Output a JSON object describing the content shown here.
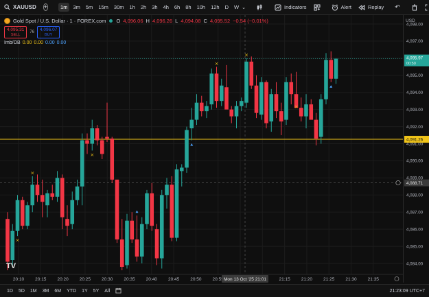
{
  "toolbar": {
    "symbol": "XAUUSD",
    "timeframes": [
      {
        "label": "1m",
        "active": true
      },
      {
        "label": "3m"
      },
      {
        "label": "5m"
      },
      {
        "label": "15m"
      },
      {
        "label": "30m"
      },
      {
        "label": "1h"
      },
      {
        "label": "2h"
      },
      {
        "label": "3h"
      },
      {
        "label": "4h"
      },
      {
        "label": "6h"
      },
      {
        "label": "8h"
      },
      {
        "label": "10h"
      },
      {
        "label": "12h"
      },
      {
        "label": "D"
      },
      {
        "label": "W"
      }
    ],
    "indicators_label": "Indicators",
    "alert_label": "Alert",
    "replay_label": "Replay"
  },
  "legend": {
    "title": "Gold Spot / U.S. Dollar · 1 · FOREX.com",
    "o_label": "O",
    "o_val": "4,096.06",
    "h_label": "H",
    "h_val": "4,096.26",
    "l_label": "L",
    "l_val": "4,094.08",
    "c_label": "C",
    "c_val": "4,095.52",
    "change": "−0.54 (−0.01%)",
    "sell_price": "4,095.31",
    "sell_label": "SELL",
    "spread": "76",
    "buy_price": "4,096.07",
    "buy_label": "BUY",
    "indicator_name": "Imb/OB",
    "indicator_values": [
      "0.00",
      "0.00",
      "0.00",
      "0.00"
    ]
  },
  "price_axis": {
    "currency": "USD",
    "labels": [
      "4,098.00",
      "4,097.00",
      "4,096.00",
      "4,095.00",
      "4,094.00",
      "4,093.00",
      "4,092.00",
      "4,091.00",
      "4,090.00",
      "4,089.00",
      "4,088.00",
      "4,087.00",
      "4,086.00",
      "4,085.00",
      "4,084.00"
    ],
    "current_price": "4,095.97",
    "countdown": "00:50",
    "line_price": "4,091.26",
    "crosshair_price": "4,088.71"
  },
  "time_axis": {
    "labels": [
      "20:10",
      "20:15",
      "20:20",
      "20:25",
      "20:30",
      "20:35",
      "20:40",
      "20:45",
      "20:50",
      "20:55",
      "21:01",
      "21:10",
      "21:15",
      "21:20",
      "21:25",
      "21:30",
      "21:35"
    ],
    "crosshair_time": "Mon 13 Oct '25  21:01"
  },
  "bottombar": {
    "ranges": [
      "1D",
      "5D",
      "1M",
      "3M",
      "6M",
      "YTD",
      "1Y",
      "5Y",
      "All"
    ],
    "clock": "21:23:09 UTC+7"
  },
  "colors": {
    "up": "#26a69a",
    "down": "#f23645",
    "line": "#f0c419",
    "bg": "#0f0f0f"
  },
  "watermark": "TV",
  "chart_data": {
    "type": "candlestick",
    "symbol": "XAUUSD",
    "interval": "1m",
    "ylim": [
      4083.6,
      4098.2
    ],
    "horizontal_line": 4091.26,
    "candles": [
      {
        "o": 4086.6,
        "h": 4087.0,
        "l": 4083.6,
        "c": 4084.1
      },
      {
        "o": 4084.2,
        "h": 4086.3,
        "l": 4083.8,
        "c": 4085.9
      },
      {
        "o": 4085.9,
        "h": 4088.0,
        "l": 4085.6,
        "c": 4087.7
      },
      {
        "o": 4087.7,
        "h": 4087.9,
        "l": 4086.0,
        "c": 4086.2
      },
      {
        "o": 4086.2,
        "h": 4087.6,
        "l": 4086.0,
        "c": 4087.4
      },
      {
        "o": 4087.4,
        "h": 4089.1,
        "l": 4087.0,
        "c": 4088.6
      },
      {
        "o": 4088.6,
        "h": 4089.2,
        "l": 4087.6,
        "c": 4088.0
      },
      {
        "o": 4088.0,
        "h": 4088.9,
        "l": 4086.7,
        "c": 4087.6
      },
      {
        "o": 4087.4,
        "h": 4088.3,
        "l": 4086.7,
        "c": 4088.1
      },
      {
        "o": 4088.1,
        "h": 4088.6,
        "l": 4087.7,
        "c": 4087.9
      },
      {
        "o": 4087.9,
        "h": 4089.4,
        "l": 4087.6,
        "c": 4089.0
      },
      {
        "o": 4089.0,
        "h": 4089.2,
        "l": 4086.0,
        "c": 4086.7
      },
      {
        "o": 4086.6,
        "h": 4087.4,
        "l": 4085.6,
        "c": 4086.2
      },
      {
        "o": 4086.3,
        "h": 4088.2,
        "l": 4086.0,
        "c": 4087.7
      },
      {
        "o": 4087.7,
        "h": 4088.9,
        "l": 4087.4,
        "c": 4088.5
      },
      {
        "o": 4088.5,
        "h": 4091.6,
        "l": 4087.4,
        "c": 4091.2
      },
      {
        "o": 4091.2,
        "h": 4091.6,
        "l": 4090.4,
        "c": 4091.0
      },
      {
        "o": 4091.0,
        "h": 4092.4,
        "l": 4090.6,
        "c": 4091.9
      },
      {
        "o": 4091.9,
        "h": 4092.1,
        "l": 4090.9,
        "c": 4091.2
      },
      {
        "o": 4091.2,
        "h": 4091.4,
        "l": 4090.1,
        "c": 4090.4
      },
      {
        "o": 4091.4,
        "h": 4093.4,
        "l": 4091.1,
        "c": 4091.3
      },
      {
        "o": 4091.3,
        "h": 4091.4,
        "l": 4088.7,
        "c": 4088.9
      },
      {
        "o": 4088.9,
        "h": 4088.9,
        "l": 4085.2,
        "c": 4085.4
      },
      {
        "o": 4085.4,
        "h": 4086.6,
        "l": 4083.6,
        "c": 4083.8
      },
      {
        "o": 4083.9,
        "h": 4086.9,
        "l": 4083.7,
        "c": 4086.5
      },
      {
        "o": 4086.5,
        "h": 4087.0,
        "l": 4085.2,
        "c": 4085.4
      },
      {
        "o": 4085.4,
        "h": 4086.8,
        "l": 4084.1,
        "c": 4084.4
      },
      {
        "o": 4084.4,
        "h": 4086.7,
        "l": 4084.0,
        "c": 4086.3
      },
      {
        "o": 4086.3,
        "h": 4088.3,
        "l": 4086.0,
        "c": 4088.1
      },
      {
        "o": 4088.1,
        "h": 4088.7,
        "l": 4085.9,
        "c": 4086.2
      },
      {
        "o": 4086.0,
        "h": 4086.3,
        "l": 4083.9,
        "c": 4084.3
      },
      {
        "o": 4084.3,
        "h": 4088.3,
        "l": 4083.7,
        "c": 4088.0
      },
      {
        "o": 4088.0,
        "h": 4089.0,
        "l": 4087.2,
        "c": 4088.6
      },
      {
        "o": 4088.6,
        "h": 4089.1,
        "l": 4085.3,
        "c": 4085.5
      },
      {
        "o": 4085.5,
        "h": 4089.8,
        "l": 4085.3,
        "c": 4089.5
      },
      {
        "o": 4089.4,
        "h": 4089.8,
        "l": 4088.5,
        "c": 4089.6
      },
      {
        "o": 4089.6,
        "h": 4092.0,
        "l": 4089.3,
        "c": 4091.8
      },
      {
        "o": 4091.9,
        "h": 4093.1,
        "l": 4091.2,
        "c": 4092.4
      },
      {
        "o": 4092.4,
        "h": 4093.9,
        "l": 4092.1,
        "c": 4093.4
      },
      {
        "o": 4093.4,
        "h": 4093.8,
        "l": 4092.6,
        "c": 4092.9
      },
      {
        "o": 4092.9,
        "h": 4093.5,
        "l": 4092.5,
        "c": 4093.2
      },
      {
        "o": 4093.3,
        "h": 4095.4,
        "l": 4093.0,
        "c": 4095.1
      },
      {
        "o": 4095.1,
        "h": 4095.5,
        "l": 4093.1,
        "c": 4093.5
      },
      {
        "o": 4093.5,
        "h": 4094.8,
        "l": 4093.2,
        "c": 4094.4
      },
      {
        "o": 4094.3,
        "h": 4095.6,
        "l": 4093.9,
        "c": 4093.0
      },
      {
        "o": 4093.0,
        "h": 4093.2,
        "l": 4092.2,
        "c": 4092.6
      },
      {
        "o": 4092.6,
        "h": 4093.5,
        "l": 4091.9,
        "c": 4093.2
      },
      {
        "o": 4093.2,
        "h": 4093.7,
        "l": 4092.9,
        "c": 4093.5
      },
      {
        "o": 4093.4,
        "h": 4096.0,
        "l": 4093.1,
        "c": 4095.8
      },
      {
        "o": 4095.8,
        "h": 4096.1,
        "l": 4094.2,
        "c": 4094.4
      },
      {
        "o": 4094.4,
        "h": 4095.0,
        "l": 4092.5,
        "c": 4092.8
      },
      {
        "o": 4092.7,
        "h": 4094.9,
        "l": 4092.4,
        "c": 4094.6
      },
      {
        "o": 4094.6,
        "h": 4094.7,
        "l": 4091.9,
        "c": 4092.2
      },
      {
        "o": 4092.3,
        "h": 4094.2,
        "l": 4091.7,
        "c": 4093.9
      },
      {
        "o": 4093.9,
        "h": 4094.6,
        "l": 4092.5,
        "c": 4092.9
      },
      {
        "o": 4092.9,
        "h": 4093.4,
        "l": 4091.5,
        "c": 4092.3
      },
      {
        "o": 4092.4,
        "h": 4094.9,
        "l": 4092.1,
        "c": 4094.6
      },
      {
        "o": 4094.6,
        "h": 4095.1,
        "l": 4093.3,
        "c": 4093.9
      },
      {
        "o": 4093.9,
        "h": 4095.2,
        "l": 4093.4,
        "c": 4093.1
      },
      {
        "o": 4093.1,
        "h": 4093.7,
        "l": 4092.3,
        "c": 4092.6
      },
      {
        "o": 4092.6,
        "h": 4093.9,
        "l": 4091.9,
        "c": 4093.3
      },
      {
        "o": 4093.3,
        "h": 4093.6,
        "l": 4092.7,
        "c": 4092.4
      },
      {
        "o": 4092.4,
        "h": 4092.8,
        "l": 4090.9,
        "c": 4091.3
      },
      {
        "o": 4091.4,
        "h": 4093.9,
        "l": 4091.0,
        "c": 4093.6
      },
      {
        "o": 4093.6,
        "h": 4096.3,
        "l": 4093.3,
        "c": 4095.9
      },
      {
        "o": 4095.9,
        "h": 4096.4,
        "l": 4094.6,
        "c": 4094.8
      },
      {
        "o": 4094.8,
        "h": 4096.0,
        "l": 4094.5,
        "c": 4095.97
      }
    ],
    "markers": [
      {
        "i": 2,
        "type": "cross",
        "where": "below"
      },
      {
        "i": 5,
        "type": "cross",
        "where": "above"
      },
      {
        "i": 17,
        "type": "cross",
        "where": "below"
      },
      {
        "i": 26,
        "type": "up-arrow",
        "where": "above"
      },
      {
        "i": 48,
        "type": "cross",
        "where": "above"
      },
      {
        "i": 42,
        "type": "cross",
        "where": "above"
      },
      {
        "i": 58,
        "type": "cross",
        "where": "below"
      },
      {
        "i": 37,
        "type": "up-arrow",
        "where": "below"
      },
      {
        "i": 65,
        "type": "up-arrow",
        "where": "below"
      }
    ]
  }
}
